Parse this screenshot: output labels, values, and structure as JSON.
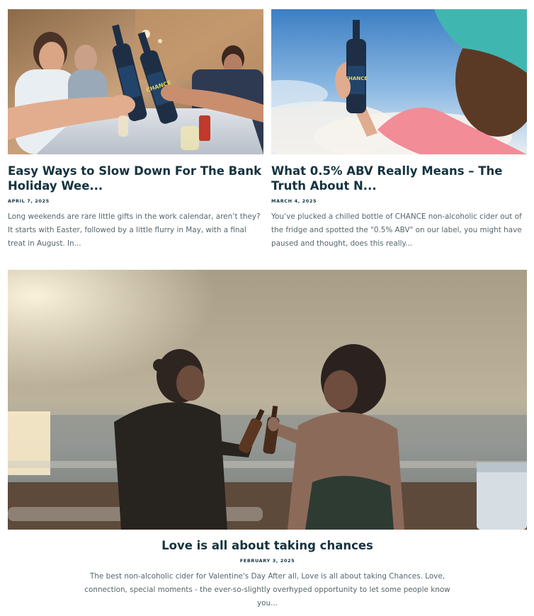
{
  "posts": [
    {
      "title": "Easy Ways to Slow Down For The Bank Holiday Wee...",
      "date": "APRIL 7, 2025",
      "excerpt": "Long weekends are rare little gifts in the work calendar, aren’t they? It starts with Easter, followed by a little flurry in May, with a final treat in August. In...",
      "label_text": "CHANCE"
    },
    {
      "title": "What 0.5% ABV Really Means – The Truth About N...",
      "date": "MARCH 4, 2025",
      "excerpt": "You’ve plucked a chilled bottle of CHANCE non-alcoholic cider out of the fridge and spotted the \"0.5% ABV\" on our label, you might have paused and thought, does this really...",
      "label_text": "CHANCE"
    },
    {
      "title": "Love is all about taking chances",
      "date": "FEBRUARY 3, 2025",
      "excerpt": "The best non-alcoholic cider for Valentine's Day After all, Love is all about taking Chances. Love, connection, special moments - the ever-so-slightly overhyped opportunity to let some people know you..."
    }
  ],
  "colors": {
    "title": "#15333f",
    "excerpt": "#55666d",
    "bottle_label": "#1f3a55",
    "label_accent": "#e8d64a"
  }
}
